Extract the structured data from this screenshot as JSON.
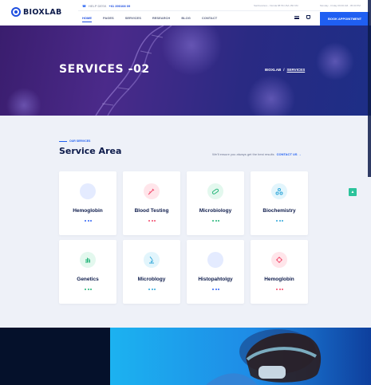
{
  "brand": {
    "name": "BIOXLAB"
  },
  "topbar": {
    "help_label": "HELP DESK",
    "phone": "+61 390108 09",
    "address_1": "Sanfrancisco - Florida 88 56 USA 150 KM",
    "address_2": "Monday - Friday 09:00 AM - 05:00 PM"
  },
  "nav": {
    "items": [
      "HOME",
      "PAGES",
      "SERVICES",
      "RESEARCH",
      "BLOG",
      "CONTACT"
    ],
    "active_index": 0
  },
  "header": {
    "book_button": "BOOK APPOINTMENT"
  },
  "hero": {
    "title": "SERVICES -02",
    "breadcrumb": [
      "BIOXLAB",
      "/",
      "SERVICES"
    ]
  },
  "section": {
    "eyebrow": "OUR SERVICES",
    "title": "Service Area",
    "assurance": "We'll ensure you always get the best results",
    "contact_link": "CONTACT US →"
  },
  "services": [
    {
      "label": "Hemoglobin",
      "icon": "blood-drop-icon",
      "icon_bg": "#e4ebff",
      "icon_color": "#2f62f5",
      "dot_color": "#2f62f5"
    },
    {
      "label": "Blood Testing",
      "icon": "syringe-icon",
      "icon_bg": "#ffe5ea",
      "icon_color": "#f24a6c",
      "dot_color": "#f24a6c"
    },
    {
      "label": "Microbiology",
      "icon": "pill-icon",
      "icon_bg": "#e3f8ee",
      "icon_color": "#22b478",
      "dot_color": "#22b478"
    },
    {
      "label": "Biochemistry",
      "icon": "molecule-icon",
      "icon_bg": "#e2f5fc",
      "icon_color": "#2fa6d8",
      "dot_color": "#2fa6d8"
    },
    {
      "label": "Genetics",
      "icon": "hand-icon",
      "icon_bg": "#e3f8ee",
      "icon_color": "#22b478",
      "dot_color": "#22b478"
    },
    {
      "label": "Microblogy",
      "icon": "microscope-icon",
      "icon_bg": "#e2f5fc",
      "icon_color": "#2fa6d8",
      "dot_color": "#2fa6d8"
    },
    {
      "label": "Histopahtolgy",
      "icon": "dna-icon",
      "icon_bg": "#e4ebff",
      "icon_color": "#2f62f5",
      "dot_color": "#2f62f5"
    },
    {
      "label": "Hemoglobin",
      "icon": "virus-icon",
      "icon_bg": "#ffe5ea",
      "icon_color": "#f24a6c",
      "dot_color": "#f24a6c"
    }
  ],
  "colors": {
    "primary": "#1f5ff2",
    "navy": "#0d1b4b",
    "accent_green": "#2bc39b"
  }
}
